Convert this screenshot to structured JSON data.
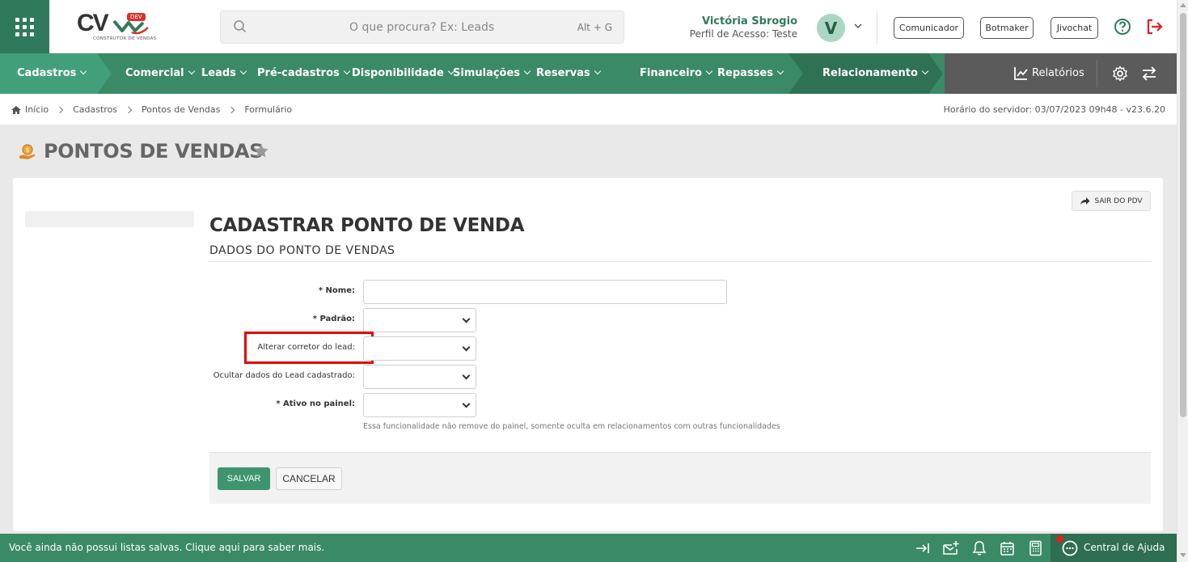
{
  "header": {
    "logo": {
      "text": "CV",
      "badge": "DEV",
      "subtitle": "CONSTRUTOR DE VENDAS"
    },
    "search": {
      "placeholder": "O que procura? Ex: Leads",
      "shortcut": "Alt + G"
    },
    "user": {
      "name": "Victória Sbrogio",
      "role": "Perfil de Acesso: Teste",
      "initial": "V"
    },
    "buttons": {
      "comunicador": "Comunicador",
      "botmaker": "Botmaker",
      "jivochat": "Jivochat"
    },
    "icons": {
      "apps": "grid-icon",
      "help": "help-circle-icon",
      "logout": "logout-icon"
    },
    "accent_color": "#2f7a5a"
  },
  "nav": {
    "items": [
      {
        "label": "Cadastros"
      },
      {
        "label": "Comercial"
      },
      {
        "label": "Leads"
      },
      {
        "label": "Pré-cadastros"
      },
      {
        "label": "Disponibilidade"
      },
      {
        "label": "Simulações"
      },
      {
        "label": "Reservas"
      },
      {
        "label": "Financeiro"
      },
      {
        "label": "Repasses"
      },
      {
        "label": "Relacionamento"
      }
    ],
    "reports": "Relatórios"
  },
  "breadcrumb": {
    "items": [
      "Início",
      "Cadastros",
      "Pontos de Vendas",
      "Formulário"
    ],
    "server_time": "Horário do servidor: 03/07/2023 09h48 - v23.6.20"
  },
  "page": {
    "title": "PONTOS DE VENDAS",
    "exit_button": "SAIR DO PDV",
    "form_title": "CADASTRAR PONTO DE VENDA",
    "form_subtitle": "DADOS DO PONTO DE VENDAS",
    "fields": [
      {
        "label": "* Nome:",
        "required": true,
        "type": "text",
        "value": ""
      },
      {
        "label": "* Padrão:",
        "required": true,
        "type": "select",
        "value": ""
      },
      {
        "label": "Alterar corretor do lead:",
        "required": false,
        "type": "select",
        "value": "",
        "highlighted": true
      },
      {
        "label": "Ocultar dados do Lead cadastrado:",
        "required": false,
        "type": "select",
        "value": ""
      },
      {
        "label": "* Ativo no painel:",
        "required": true,
        "type": "select",
        "value": ""
      }
    ],
    "help_text": "Essa funcionalidade não remove do painel, somente oculta em relacionamentos com outras funcionalidades",
    "save_label": "SALVAR",
    "cancel_label": "CANCELAR",
    "highlight_color": "#e50000"
  },
  "footer": {
    "message": "Você ainda não possui listas salvas. Clique aqui para saber mais.",
    "help_center": "Central de Ajuda",
    "icons": [
      "collapse-right-icon",
      "mail-add-icon",
      "bell-icon",
      "calendar-icon",
      "calculator-icon",
      "chat-icon"
    ]
  }
}
